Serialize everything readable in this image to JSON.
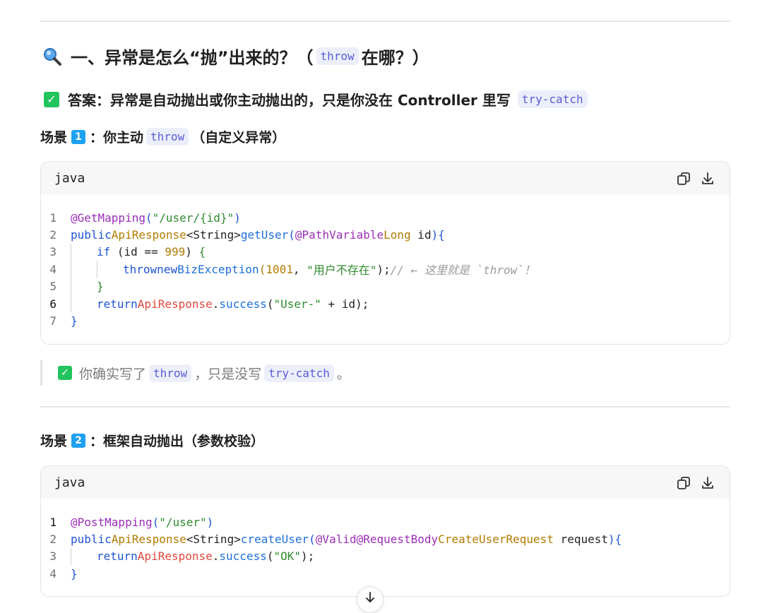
{
  "section_title": {
    "prefix": "一、异常是怎么“抛”出来的？（",
    "code": "throw",
    "suffix": "在哪？）"
  },
  "answer": {
    "text": "答案：异常是自动抛出或你主动抛出的，只是你没在 Controller 里写",
    "code": "try-catch"
  },
  "scene1": {
    "prefix": "场景",
    "key": "1",
    "middle": "：你主动",
    "code": "throw",
    "suffix": "（自定义异常）"
  },
  "scene2": {
    "prefix": "场景",
    "key": "2",
    "middle": "：框架自动抛出（参数校验）"
  },
  "code_block_1": {
    "language": "java",
    "line_numbers": [
      "1",
      "2",
      "3",
      "4",
      "5",
      "6",
      "7"
    ],
    "tokens": {
      "l1_ann": "@GetMapping",
      "l1_open": "(",
      "l1_str": "\"/user/{id}\"",
      "l1_close": ")",
      "l2_pub": "public",
      "l2_type": "ApiResponse",
      "l2_gen": "<String>",
      "l2_fn": "getUser",
      "l2_open": "(",
      "l2_ann": "@PathVariable",
      "l2_ptype": "Long",
      "l2_pname": " id",
      "l2_close": ")",
      "l2_brace": "{",
      "l3_if": "if",
      "l3_cond1": " (id == ",
      "l3_num": "999",
      "l3_cond2": ") ",
      "l3_brace": "{",
      "l4_throw": "throw",
      "l4_new": "new",
      "l4_cls": "BizException",
      "l4_open": "(",
      "l4_num": "1001",
      "l4_comma": ", ",
      "l4_str": "\"用户不存在\"",
      "l4_close": ");",
      "l4_comment": "// ← 这里就是 `throw`！",
      "l5_brace": "}",
      "l6_ret": "return",
      "l6_cls": "ApiResponse",
      "l6_dot": ".",
      "l6_fn": "success",
      "l6_open": "(",
      "l6_str": "\"User-\"",
      "l6_rest": " + id);",
      "l7_brace": "}"
    }
  },
  "quote": {
    "prefix": "你确实写了",
    "code1": "throw",
    "middle": "，只是没写",
    "code2": "try-catch",
    "suffix": "。"
  },
  "code_block_2": {
    "language": "java",
    "line_numbers": [
      "1",
      "2",
      "3",
      "4"
    ],
    "tokens": {
      "l1_ann": "@PostMapping",
      "l1_open": "(",
      "l1_str": "\"/user\"",
      "l1_close": ")",
      "l2_pub": "public",
      "l2_type": "ApiResponse",
      "l2_gen": "<String>",
      "l2_fn": "createUser",
      "l2_open": "(",
      "l2_ann1": "@Valid",
      "l2_ann2": "@RequestBody",
      "l2_ptype": "CreateUserRequest",
      "l2_pname": " request",
      "l2_close": ")",
      "l2_brace": "{",
      "l3_ret": "return",
      "l3_cls": "ApiResponse",
      "l3_dot": ".",
      "l3_fn": "success",
      "l3_open": "(",
      "l3_str": "\"OK\"",
      "l3_close": ");",
      "l4_brace": "}"
    }
  },
  "icons": {
    "heading": "magnifier-icon",
    "check": "check-box-icon",
    "copy": "copy-icon",
    "download": "download-icon",
    "scroll": "arrow-down-icon"
  },
  "colors": {
    "inline_code_text": "#5b5bd6",
    "inline_code_bg": "#eceffa",
    "check_green": "#21c45d",
    "keycap_blue": "#1da1f2"
  }
}
